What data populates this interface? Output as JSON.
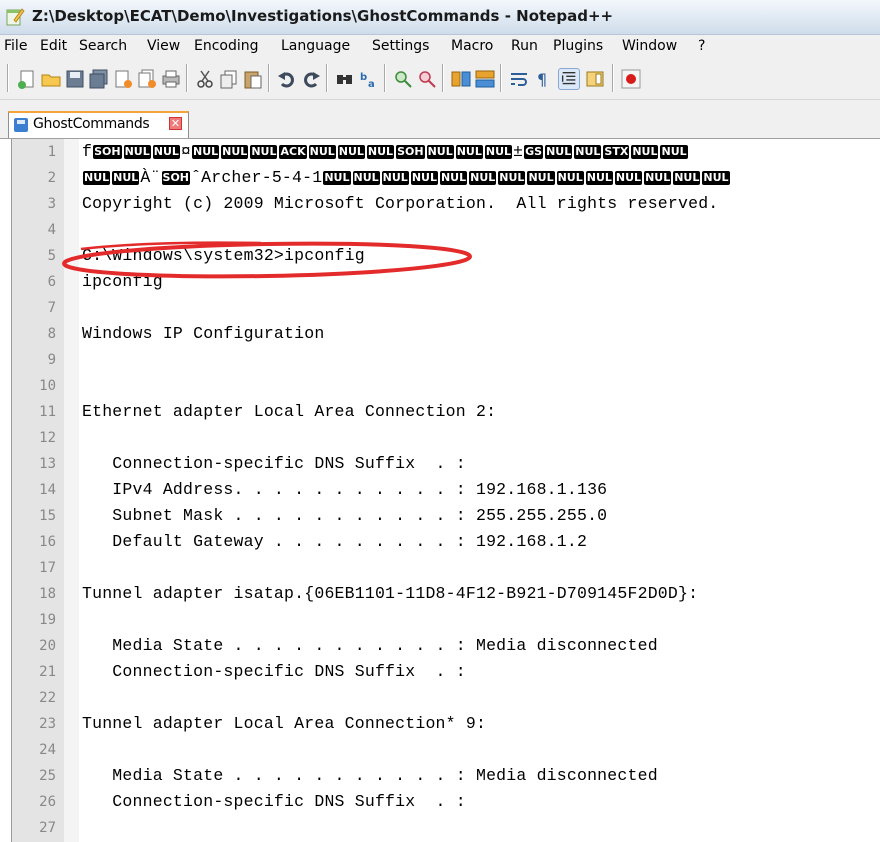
{
  "window": {
    "title": "Z:\\Desktop\\ECAT\\Demo\\Investigations\\GhostCommands - Notepad++"
  },
  "menu": [
    "File",
    "Edit",
    "Search",
    "View",
    "Encoding",
    "Language",
    "Settings",
    "Macro",
    "Run",
    "Plugins",
    "Window",
    "?"
  ],
  "toolbar": {
    "buttons": [
      "new-file-icon",
      "open-file-icon",
      "save-icon",
      "save-all-icon",
      "close-icon",
      "close-all-icon",
      "print-icon",
      "cut-icon",
      "copy-icon",
      "paste-icon",
      "undo-icon",
      "redo-icon",
      "find-icon",
      "replace-icon",
      "zoom-in-icon",
      "zoom-out-icon",
      "sync-vertical-icon",
      "sync-horizontal-icon",
      "word-wrap-icon",
      "show-all-chars-icon",
      "indent-guide-icon",
      "document-map-icon",
      "record-macro-icon"
    ]
  },
  "tab": {
    "label": "GhostCommands",
    "close_glyph": "✕"
  },
  "colors": {
    "annotation_ellipse": "#e32b2b",
    "tab_accent": "#f3a53b",
    "control_char_bg": "#000000"
  },
  "editor": {
    "lines": [
      {
        "n": "1",
        "segments": [
          [
            "t",
            "f"
          ],
          [
            "c",
            "SOH"
          ],
          [
            "c",
            "NUL"
          ],
          [
            "c",
            "NUL"
          ],
          [
            "t",
            "¤"
          ],
          [
            "c",
            "NUL"
          ],
          [
            "c",
            "NUL"
          ],
          [
            "c",
            "NUL"
          ],
          [
            "c",
            "ACK"
          ],
          [
            "c",
            "NUL"
          ],
          [
            "c",
            "NUL"
          ],
          [
            "c",
            "NUL"
          ],
          [
            "c",
            "SOH"
          ],
          [
            "c",
            "NUL"
          ],
          [
            "c",
            "NUL"
          ],
          [
            "c",
            "NUL"
          ],
          [
            "t",
            "±"
          ],
          [
            "c",
            "GS"
          ],
          [
            "c",
            "NUL"
          ],
          [
            "c",
            "NUL"
          ],
          [
            "c",
            "STX"
          ],
          [
            "c",
            "NUL"
          ],
          [
            "c",
            "NUL"
          ]
        ]
      },
      {
        "n": "2",
        "segments": [
          [
            "c",
            "NUL"
          ],
          [
            "c",
            "NUL"
          ],
          [
            "t",
            "À¨"
          ],
          [
            "c",
            "SOH"
          ],
          [
            "t",
            "ˆArcher-5-4-1"
          ],
          [
            "c",
            "NUL"
          ],
          [
            "c",
            "NUL"
          ],
          [
            "c",
            "NUL"
          ],
          [
            "c",
            "NUL"
          ],
          [
            "c",
            "NUL"
          ],
          [
            "c",
            "NUL"
          ],
          [
            "c",
            "NUL"
          ],
          [
            "c",
            "NUL"
          ],
          [
            "c",
            "NUL"
          ],
          [
            "c",
            "NUL"
          ],
          [
            "c",
            "NUL"
          ],
          [
            "c",
            "NUL"
          ],
          [
            "c",
            "NUL"
          ],
          [
            "c",
            "NUL"
          ]
        ]
      },
      {
        "n": "3",
        "text": "Copyright (c) 2009 Microsoft Corporation.  All rights reserved."
      },
      {
        "n": "4",
        "text": ""
      },
      {
        "n": "5",
        "text": "C:\\Windows\\system32>ipconfig"
      },
      {
        "n": "6",
        "text": "ipconfig"
      },
      {
        "n": "7",
        "text": ""
      },
      {
        "n": "8",
        "text": "Windows IP Configuration"
      },
      {
        "n": "9",
        "text": ""
      },
      {
        "n": "10",
        "text": ""
      },
      {
        "n": "11",
        "text": "Ethernet adapter Local Area Connection 2:"
      },
      {
        "n": "12",
        "text": ""
      },
      {
        "n": "13",
        "text": "   Connection-specific DNS Suffix  . :"
      },
      {
        "n": "14",
        "text": "   IPv4 Address. . . . . . . . . . . : 192.168.1.136"
      },
      {
        "n": "15",
        "text": "   Subnet Mask . . . . . . . . . . . : 255.255.255.0"
      },
      {
        "n": "16",
        "text": "   Default Gateway . . . . . . . . . : 192.168.1.2"
      },
      {
        "n": "17",
        "text": ""
      },
      {
        "n": "18",
        "text": "Tunnel adapter isatap.{06EB1101-11D8-4F12-B921-D709145F2D0D}:"
      },
      {
        "n": "19",
        "text": ""
      },
      {
        "n": "20",
        "text": "   Media State . . . . . . . . . . . : Media disconnected"
      },
      {
        "n": "21",
        "text": "   Connection-specific DNS Suffix  . :"
      },
      {
        "n": "22",
        "text": ""
      },
      {
        "n": "23",
        "text": "Tunnel adapter Local Area Connection* 9:"
      },
      {
        "n": "24",
        "text": ""
      },
      {
        "n": "25",
        "text": "   Media State . . . . . . . . . . . : Media disconnected"
      },
      {
        "n": "26",
        "text": "   Connection-specific DNS Suffix  . :"
      },
      {
        "n": "27",
        "text": ""
      }
    ]
  }
}
